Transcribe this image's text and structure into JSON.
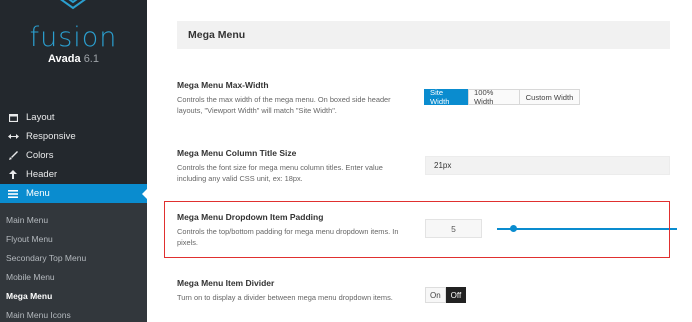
{
  "brand": {
    "logo_text": "fusion",
    "product": "Avada",
    "version": "6.1"
  },
  "main_nav": [
    {
      "label": "Layout",
      "icon": "layout-icon",
      "active": false
    },
    {
      "label": "Responsive",
      "icon": "arrows-horizontal-icon",
      "active": false
    },
    {
      "label": "Colors",
      "icon": "brush-icon",
      "active": false
    },
    {
      "label": "Header",
      "icon": "header-arrow-icon",
      "active": false
    },
    {
      "label": "Menu",
      "icon": "hamburger-icon",
      "active": true
    }
  ],
  "sub_nav": [
    {
      "label": "Main Menu",
      "current": false
    },
    {
      "label": "Flyout Menu",
      "current": false
    },
    {
      "label": "Secondary Top Menu",
      "current": false
    },
    {
      "label": "Mobile Menu",
      "current": false
    },
    {
      "label": "Mega Menu",
      "current": true
    },
    {
      "label": "Main Menu Icons",
      "current": false
    }
  ],
  "section": {
    "title": "Mega Menu"
  },
  "max_width": {
    "title": "Mega Menu Max-Width",
    "desc": "Controls the max width of the mega menu. On boxed side header layouts, \"Viewport Width\" will match \"Site Width\".",
    "options": [
      "Site Width",
      "100% Width",
      "Custom Width"
    ],
    "selected": "Site Width"
  },
  "column_title": {
    "title": "Mega Menu Column Title Size",
    "desc": "Controls the font size for mega menu column titles. Enter value including any valid CSS unit, ex: 18px.",
    "value": "21px"
  },
  "item_padding": {
    "title": "Mega Menu Dropdown Item Padding",
    "desc": "Controls the top/bottom padding for mega menu dropdown items. In pixels.",
    "value": "5",
    "slider_fraction": 0.09
  },
  "item_divider": {
    "title": "Mega Menu Item Divider",
    "desc": "Turn on to display a divider between mega menu dropdown items.",
    "on_label": "On",
    "off_label": "Off",
    "state": "Off"
  },
  "colors": {
    "accent": "#0a8ccf",
    "sidebar_bg": "#23282d",
    "submenu_bg": "#32373c",
    "highlight_border": "#e0302f"
  }
}
